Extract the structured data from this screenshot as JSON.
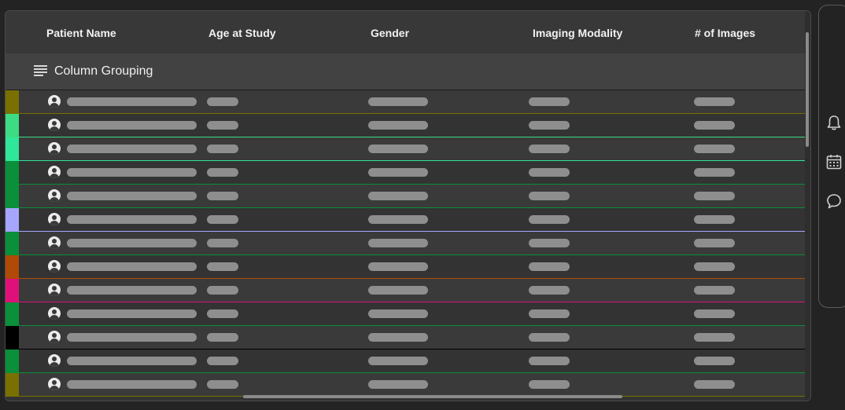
{
  "table": {
    "columns": [
      {
        "label": "Patient Name"
      },
      {
        "label": "Age at Study"
      },
      {
        "label": "Gender"
      },
      {
        "label": "Imaging Modality"
      },
      {
        "label": "# of Images"
      }
    ],
    "grouping_label": "Column Grouping",
    "rows": [
      {
        "color": "#7a7000"
      },
      {
        "color": "#3ddc84"
      },
      {
        "color": "#2fe69a"
      },
      {
        "color": "#0a8f3a"
      },
      {
        "color": "#0a8f3a"
      },
      {
        "color": "#a6a6ff"
      },
      {
        "color": "#0a8f3a"
      },
      {
        "color": "#b04a06"
      },
      {
        "color": "#e0107a"
      },
      {
        "color": "#0a8f3a"
      },
      {
        "color": "#000000"
      },
      {
        "color": "#0a8f3a"
      },
      {
        "color": "#7a7000"
      }
    ]
  },
  "side_rail": {
    "icons": [
      "bell-icon",
      "calendar-icon",
      "chat-icon"
    ]
  }
}
